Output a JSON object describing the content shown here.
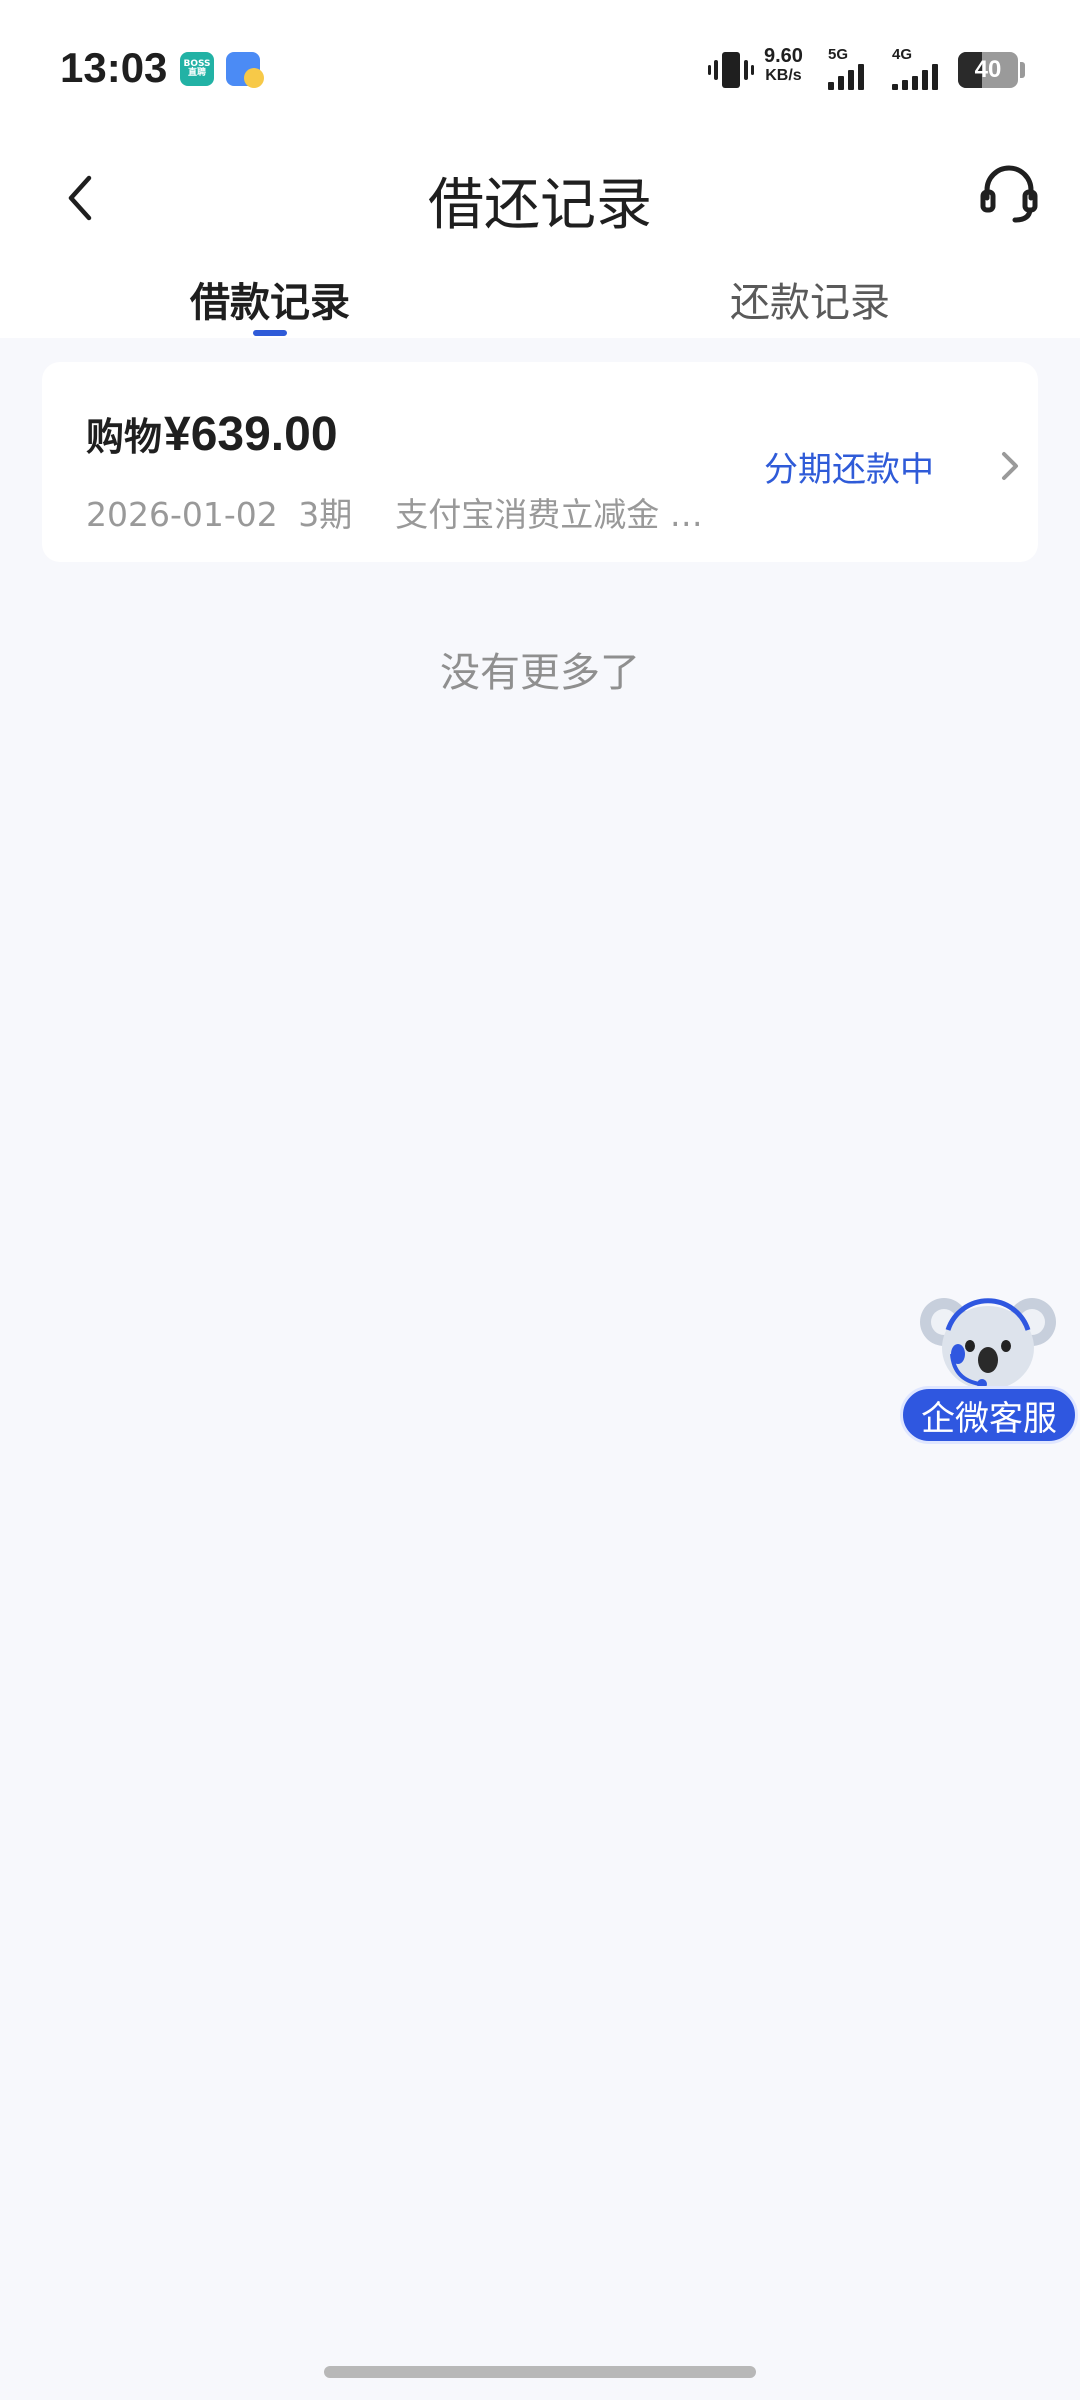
{
  "status_bar": {
    "time": "13:03",
    "apps": [
      {
        "name": "boss-zhipin",
        "text": "BOSS\n直聘"
      },
      {
        "name": "doc-app",
        "text": ""
      }
    ],
    "net_speed_value": "9.60",
    "net_speed_unit": "KB/s",
    "network_1": "5G",
    "network_2": "4G",
    "battery_level": "40"
  },
  "header": {
    "title": "借还记录",
    "back_icon": "chevron-left-icon",
    "support_icon": "headset-icon"
  },
  "tabs": [
    {
      "label": "借款记录",
      "active": true
    },
    {
      "label": "还款记录",
      "active": false
    }
  ],
  "records": [
    {
      "type": "购物",
      "amount": "¥639.00",
      "date": "2026-01-02",
      "term": "3期",
      "note": "支付宝消费立减金 …",
      "status": "分期还款中"
    }
  ],
  "list_end_text": "没有更多了",
  "float_service": {
    "label": "企微客服"
  },
  "colors": {
    "accent": "#2f5bd8",
    "page_bg": "#f7f8fc",
    "card_bg": "#ffffff",
    "muted_text": "#999999"
  }
}
